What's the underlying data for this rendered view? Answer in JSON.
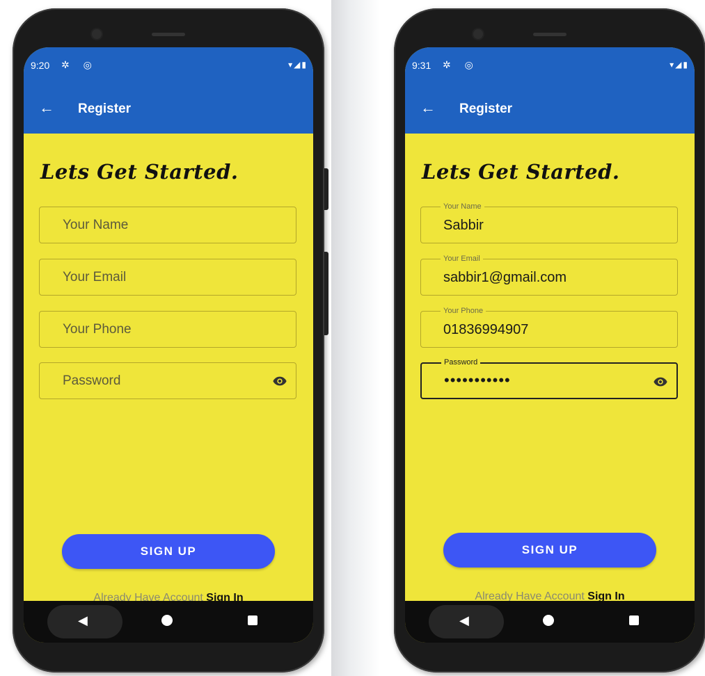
{
  "screens": [
    {
      "status": {
        "time": "9:20",
        "left_icons": "✲ ◎",
        "right_icons": "▾◢▮"
      },
      "appbar": {
        "back_icon": "←",
        "title": "Register"
      },
      "headline": "Lets Get Started.",
      "fields": {
        "name": {
          "placeholder": "Your Name"
        },
        "email": {
          "placeholder": "Your Email"
        },
        "phone": {
          "placeholder": "Your Phone"
        },
        "password": {
          "placeholder": "Password"
        }
      },
      "signup_label": "SIGN UP",
      "footer": {
        "prompt": "Already Have Account",
        "link": "Sign In"
      },
      "nav": {
        "back": "◀"
      }
    },
    {
      "status": {
        "time": "9:31",
        "left_icons": "✲ ◎",
        "right_icons": "▾◢▮"
      },
      "appbar": {
        "back_icon": "←",
        "title": "Register"
      },
      "headline": "Lets Get Started.",
      "fields": {
        "name": {
          "label": "Your Name",
          "value": "Sabbir"
        },
        "email": {
          "label": "Your Email",
          "value": "sabbir1@gmail.com"
        },
        "phone": {
          "label": "Your Phone",
          "value": "01836994907"
        },
        "password": {
          "label": "Password",
          "value": "•••••••••••"
        }
      },
      "signup_label": "SIGN UP",
      "footer": {
        "prompt": "Already Have Account",
        "link": "Sign In"
      },
      "nav": {
        "back": "◀"
      }
    }
  ],
  "colors": {
    "appbar": "#1f62c1",
    "background": "#efe53a",
    "button": "#3d56f5"
  }
}
